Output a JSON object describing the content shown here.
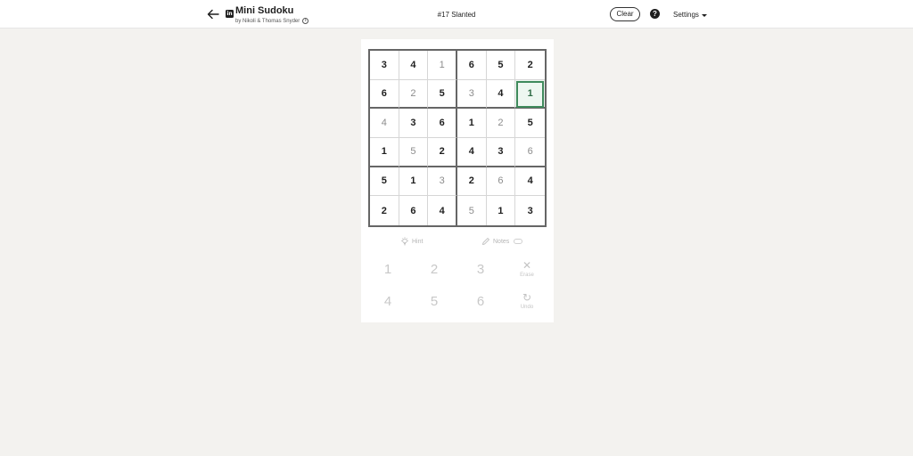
{
  "header": {
    "app_title": "Mini Sudoku",
    "byline": "by Nikoli & Thomas Snyder",
    "puzzle_title": "#17 Slanted",
    "clear_label": "Clear",
    "help_label": "?",
    "settings_label": "Settings",
    "logo_text": "in"
  },
  "grid": {
    "values": [
      [
        "3",
        "4",
        "1",
        "6",
        "5",
        "2"
      ],
      [
        "6",
        "2",
        "5",
        "3",
        "4",
        "1"
      ],
      [
        "4",
        "3",
        "6",
        "1",
        "2",
        "5"
      ],
      [
        "1",
        "5",
        "2",
        "4",
        "3",
        "6"
      ],
      [
        "5",
        "1",
        "3",
        "2",
        "6",
        "4"
      ],
      [
        "2",
        "6",
        "4",
        "5",
        "1",
        "3"
      ]
    ],
    "given": [
      [
        true,
        true,
        false,
        true,
        true,
        true
      ],
      [
        true,
        false,
        true,
        false,
        true,
        false
      ],
      [
        false,
        true,
        true,
        true,
        false,
        true
      ],
      [
        true,
        false,
        true,
        true,
        true,
        false
      ],
      [
        true,
        true,
        false,
        true,
        false,
        true
      ],
      [
        true,
        true,
        true,
        false,
        true,
        true
      ]
    ],
    "selected": [
      1,
      5
    ],
    "accent_color": "#3f8a5c"
  },
  "tools": {
    "hint_label": "Hint",
    "notes_label": "Notes"
  },
  "keypad": {
    "numbers": [
      "1",
      "2",
      "3",
      "4",
      "5",
      "6"
    ],
    "erase_label": "Erase",
    "undo_label": "Undo"
  }
}
